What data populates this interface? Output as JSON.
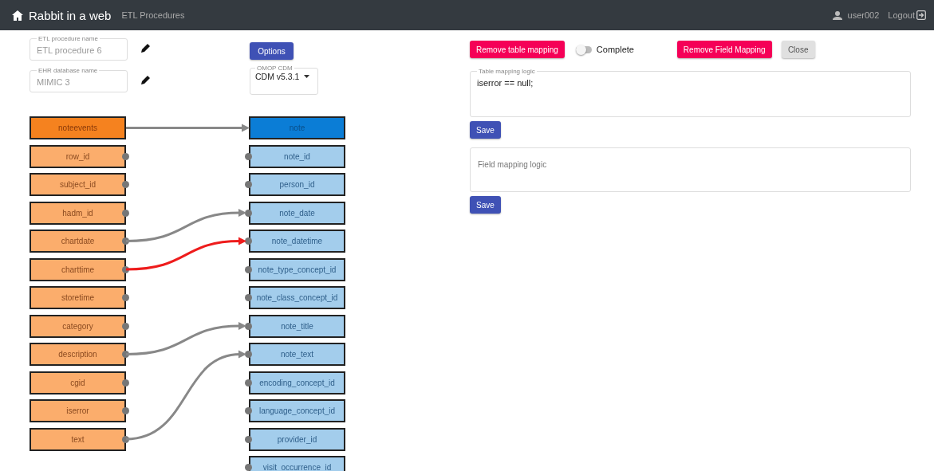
{
  "navbar": {
    "brand": "Rabbit in a web",
    "link": "ETL Procedures",
    "user": "user002",
    "logout": "Logout"
  },
  "procedure_form": {
    "procedure_name": {
      "label": "ETL procedure name",
      "value": "ETL procedure 6",
      "disabled": true
    },
    "database_name": {
      "label": "EHR database name",
      "value": "MIMIC 3",
      "disabled": true
    },
    "options_button": "Options",
    "cdm_select": {
      "label": "OMOP CDM",
      "value": "CDM v5.3.1"
    }
  },
  "source_table": {
    "name": "noteevents",
    "mapped": true,
    "fields": [
      {
        "name": "row_id",
        "connected": false
      },
      {
        "name": "subject_id",
        "connected": false
      },
      {
        "name": "hadm_id",
        "connected": false
      },
      {
        "name": "chartdate",
        "connected": true
      },
      {
        "name": "charttime",
        "connected": true
      },
      {
        "name": "storetime",
        "connected": false
      },
      {
        "name": "category",
        "connected": false
      },
      {
        "name": "description",
        "connected": true
      },
      {
        "name": "cgid",
        "connected": false
      },
      {
        "name": "iserror",
        "connected": false
      },
      {
        "name": "text",
        "connected": true
      }
    ]
  },
  "field_mappings": [
    {
      "selected": false
    },
    {
      "selected": true
    },
    {
      "selected": false
    },
    {
      "selected": false
    }
  ],
  "target_table": {
    "name": "note",
    "fields": [
      {
        "name": "note_id",
        "connected": false
      },
      {
        "name": "person_id",
        "connected": false
      },
      {
        "name": "note_date",
        "connected": true
      },
      {
        "name": "note_datetime",
        "connected": true
      },
      {
        "name": "note_type_concept_id",
        "connected": false
      },
      {
        "name": "note_class_concept_id",
        "connected": false
      },
      {
        "name": "note_title",
        "connected": true
      },
      {
        "name": "note_text",
        "connected": true
      },
      {
        "name": "encoding_concept_id",
        "connected": false
      },
      {
        "name": "language_concept_id",
        "connected": false
      },
      {
        "name": "provider_id",
        "connected": false
      },
      {
        "name": "visit_occurrence_id",
        "connected": false
      }
    ]
  },
  "mapping_panel": {
    "remove_table_button": "Remove table mapping",
    "complete": {
      "label": "Complete",
      "on": false
    },
    "remove_field_button": "Remove Field Mapping",
    "close_button": "Close",
    "table_logic": {
      "label": "Table mapping logic",
      "value": "iserror == null;"
    },
    "save_button_1": "Save",
    "field_logic": {
      "placeholder": "Field mapping logic"
    },
    "save_button_2": "Save"
  }
}
